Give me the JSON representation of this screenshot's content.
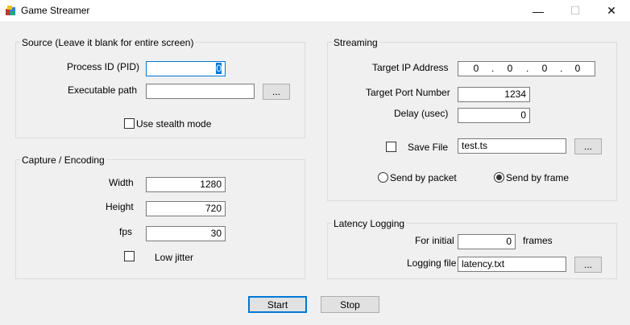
{
  "window": {
    "title": "Game Streamer",
    "controls": {
      "minimize": "—",
      "maximize": "☐",
      "close": "✕"
    }
  },
  "source": {
    "group_label": "Source (Leave it blank for entire screen)",
    "pid_label": "Process ID (PID)",
    "pid_value": "0",
    "exe_label": "Executable path",
    "exe_value": "",
    "browse_label": "...",
    "stealth_label": "Use stealth mode",
    "stealth_checked": false
  },
  "capture": {
    "group_label": "Capture / Encoding",
    "width_label": "Width",
    "width_value": "1280",
    "height_label": "Height",
    "height_value": "720",
    "fps_label": "fps",
    "fps_value": "30",
    "lowjitter_label": "Low jitter",
    "lowjitter_checked": false
  },
  "streaming": {
    "group_label": "Streaming",
    "ip_label": "Target IP Address",
    "ip_octets": [
      "0",
      "0",
      "0",
      "0"
    ],
    "ip_dot": ".",
    "port_label": "Target Port Number",
    "port_value": "1234",
    "delay_label": "Delay (usec)",
    "delay_value": "0",
    "savefile_label": "Save File",
    "savefile_checked": false,
    "savefile_value": "test.ts",
    "browse_label": "...",
    "send_packet_label": "Send by packet",
    "send_frame_label": "Send by frame",
    "send_mode": "frame"
  },
  "latency": {
    "group_label": "Latency Logging",
    "initial_label": "For initial",
    "initial_value": "0",
    "frames_label": "frames",
    "logfile_label": "Logging file",
    "logfile_value": "latency.txt",
    "browse_label": "..."
  },
  "actions": {
    "start_label": "Start",
    "stop_label": "Stop"
  }
}
